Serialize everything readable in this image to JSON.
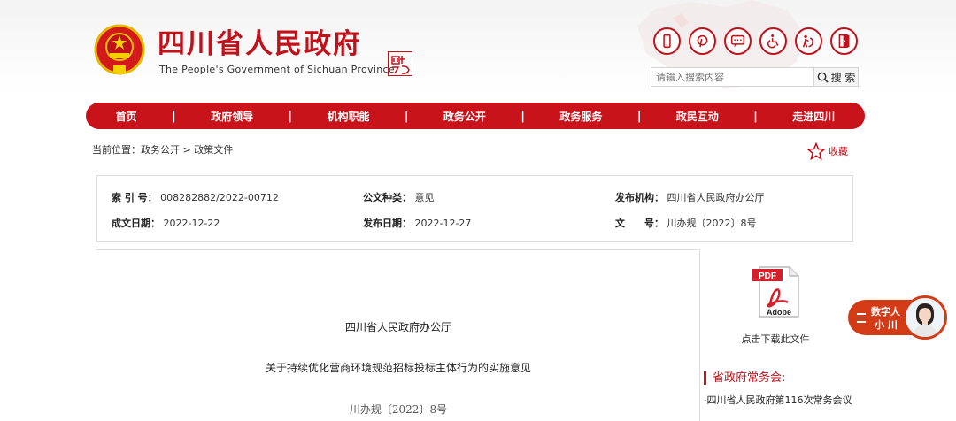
{
  "header": {
    "title": "四川省人民政府",
    "subtitle": "The People's Government of Sichuan Province",
    "icons": [
      "phone-icon",
      "pinterest-icon",
      "chat-icon",
      "wheelchair-icon",
      "elderly-care-icon",
      "exit-icon"
    ]
  },
  "search": {
    "placeholder": "请输入搜索内容",
    "button_label": "搜 索"
  },
  "nav": {
    "items": [
      "首页",
      "政府领导",
      "机构职能",
      "政务公开",
      "政务服务",
      "政民互动",
      "走进四川"
    ]
  },
  "breadcrumb": {
    "prefix": "当前位置：",
    "level1": "政务公开",
    "separator": ">",
    "level2": "政策文件"
  },
  "favorite_label": "收藏",
  "meta": {
    "index_label": "索 引 号：",
    "index_value": "008282882/2022-00712",
    "type_label": "公文种类：",
    "type_value": "意见",
    "org_label": "发布机构：",
    "org_value": "四川省人民政府办公厅",
    "created_label": "成文日期：",
    "created_value": "2022-12-22",
    "published_label": "发布日期：",
    "published_value": "2022-12-27",
    "doc_label": "文　　号：",
    "doc_value": "川办规〔2022〕8号"
  },
  "document": {
    "issuer": "四川省人民政府办公厅",
    "title": "关于持续优化营商环境规范招标投标主体行为的实施意见",
    "number": "川办规〔2022〕8号"
  },
  "sidebar": {
    "pdf_label": "PDF",
    "adobe_label": "Adobe",
    "download_label": "点击下载此文件",
    "heading": "省政府常务会:",
    "link": "·四川省人民政府第116次常务会议"
  },
  "assistant": {
    "line1": "数字人",
    "line2": "小 川"
  },
  "seal_text": "中国四川"
}
